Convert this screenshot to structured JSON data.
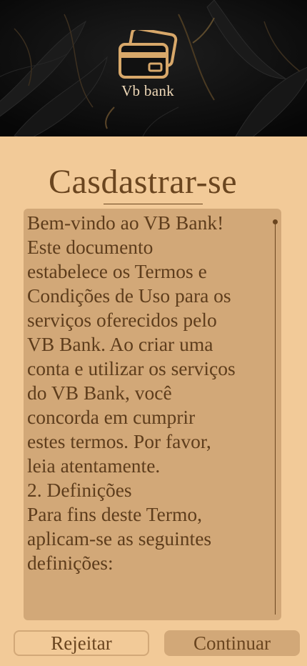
{
  "header": {
    "brand_name": "Vb bank"
  },
  "page": {
    "title": "Casdastrar-se"
  },
  "terms": {
    "lines": [
      "Bem-vindo ao VB Bank!",
      "Este documento",
      "estabelece os Termos e",
      "Condições de Uso para os",
      "serviços oferecidos pelo",
      "VB Bank. Ao criar uma",
      "conta e utilizar os serviços",
      "do VB Bank, você",
      "concorda em cumprir",
      "estes termos. Por favor,",
      "leia atentamente.",
      "2. Definições",
      "Para fins deste Termo,",
      "aplicam-se as seguintes",
      "definições:"
    ]
  },
  "actions": {
    "reject_label": "Rejeitar",
    "continue_label": "Continuar"
  },
  "colors": {
    "background": "#f2ca98",
    "panel": "#d2a878",
    "text": "#6a451f",
    "header_dark": "#0f0f0f",
    "logo_gold": "#d8a86a"
  },
  "icons": {
    "logo": "credit-cards-icon"
  }
}
